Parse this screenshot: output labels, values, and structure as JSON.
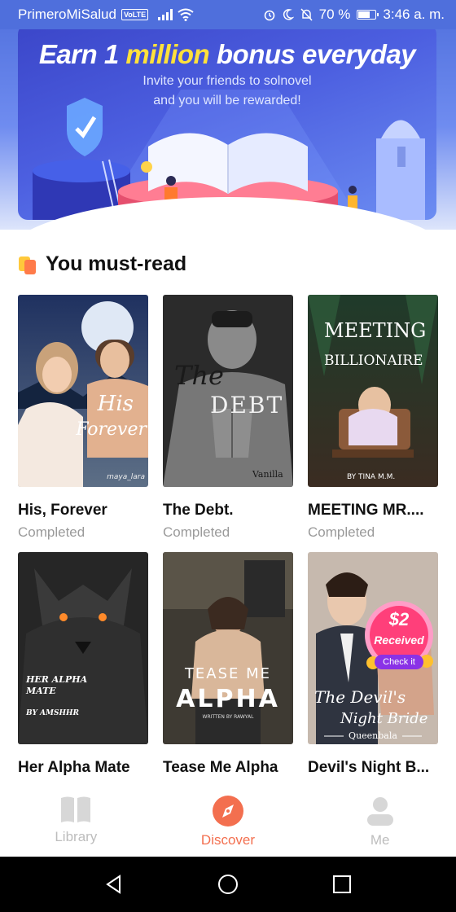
{
  "status_bar": {
    "carrier": "PrimeroMiSalud",
    "volte": "VoLTE",
    "battery": "70 %",
    "battery_level": 0.7,
    "time": "3:46 a. m."
  },
  "banner": {
    "title_prefix": "Earn 1",
    "title_highlight": "million",
    "title_suffix": "bonus everyday",
    "subtitle_line1": "Invite your friends to solnovel",
    "subtitle_line2": "and you will be rewarded!",
    "slides": 5,
    "active_slide": 0
  },
  "section": {
    "title": "You must-read"
  },
  "books": [
    {
      "title": "His, Forever",
      "status": "Completed",
      "cover_text": "His Forever",
      "cover_author": "maya_lara"
    },
    {
      "title": "The Debt.",
      "status": "Completed",
      "cover_text": "The Debt",
      "cover_author": "Vanilla"
    },
    {
      "title": "MEETING MR....",
      "status": "Completed",
      "cover_text": "Meeting Mr. Billionaire",
      "cover_author": "BY TINA M.M."
    },
    {
      "title": "Her Alpha Mate",
      "status": "",
      "cover_text": "Her Alpha Mate",
      "cover_author": "BY AMSHHR"
    },
    {
      "title": "Tease Me Alpha",
      "status": "",
      "cover_text": "TEASE ME ALPHA",
      "cover_author": "WRITTEN BY RAWYAL"
    },
    {
      "title": "Devil's Night B...",
      "status": "",
      "cover_text": "The Devil's Night Bride",
      "cover_author": "Queenbala"
    }
  ],
  "promo_badge": {
    "amount": "$2",
    "label": "Received",
    "button": "Check it"
  },
  "bottom_nav": {
    "library": "Library",
    "discover": "Discover",
    "me": "Me"
  },
  "colors": {
    "accent": "#f36f4f",
    "banner_blue": "#4f6fdc",
    "muted": "#9a9a9a"
  }
}
